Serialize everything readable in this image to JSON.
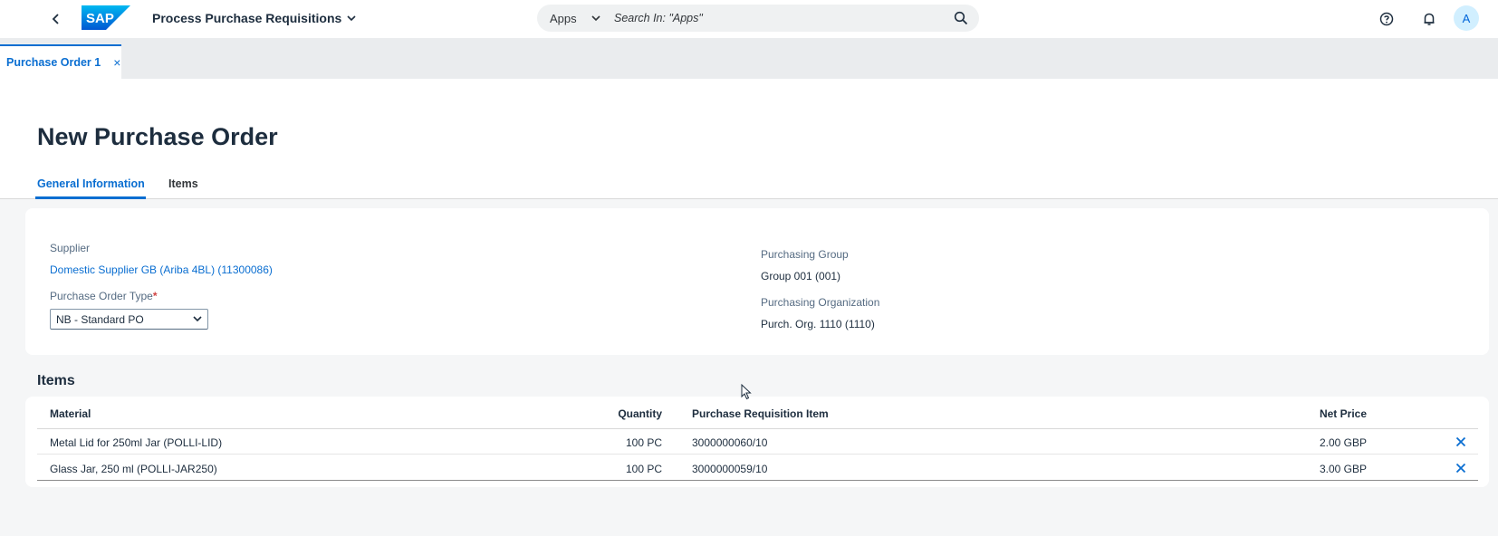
{
  "shell": {
    "back_icon": "back-arrow-icon",
    "logo_icon": "sap-logo",
    "app_title": "Process Purchase Requisitions",
    "search": {
      "scope": "Apps",
      "placeholder": "Search In: \"Apps\""
    },
    "avatar_initial": "A",
    "icons": [
      "help-icon",
      "notification-bell-icon",
      "search-icon"
    ]
  },
  "tabs": {
    "open": [
      {
        "label": "Purchase Order 1",
        "close": "×"
      }
    ]
  },
  "page": {
    "title": "New Purchase Order",
    "anchors": [
      {
        "label": "General Information",
        "active": true
      },
      {
        "label": "Items",
        "active": false
      }
    ]
  },
  "general": {
    "supplier_label": "Supplier",
    "supplier_value": "Domestic Supplier GB (Ariba 4BL) (11300086)",
    "po_type_label": "Purchase Order Type",
    "po_type_required": "*",
    "po_type_value": "NB - Standard PO",
    "purch_group_label": "Purchasing Group",
    "purch_group_value": "Group 001 (001)",
    "purch_org_label": "Purchasing Organization",
    "purch_org_value": "Purch. Org. 1110 (1110)"
  },
  "items": {
    "heading": "Items",
    "columns": {
      "material": "Material",
      "quantity": "Quantity",
      "pr_item": "Purchase Requisition Item",
      "net_price": "Net Price"
    },
    "rows": [
      {
        "material": "Metal Lid for 250ml Jar (POLLI-LID)",
        "quantity": "100 PC",
        "pr_item": "3000000060/10",
        "net_price": "2.00 GBP"
      },
      {
        "material": "Glass Jar, 250 ml (POLLI-JAR250)",
        "quantity": "100 PC",
        "pr_item": "3000000059/10",
        "net_price": "3.00 GBP"
      }
    ]
  },
  "colors": {
    "brand_blue": "#0a6ed1",
    "required_red": "#d04343",
    "shell_bg": "#ffffff",
    "page_bg": "#f5f6f7"
  }
}
